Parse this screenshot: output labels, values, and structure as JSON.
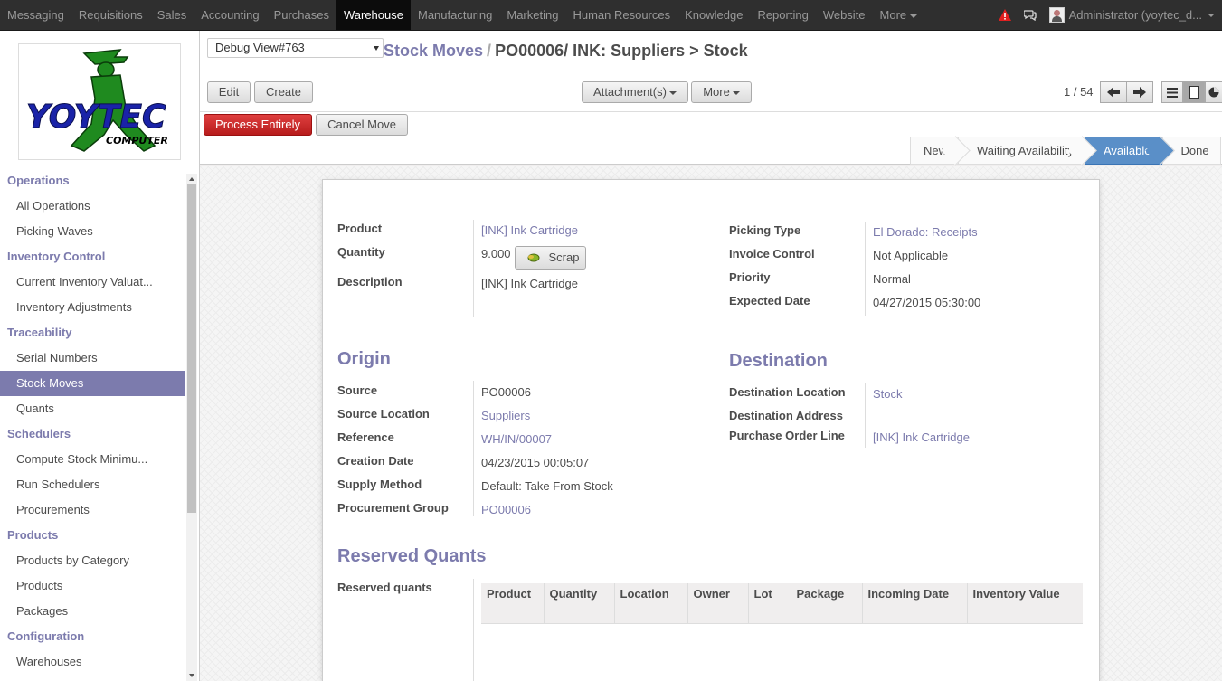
{
  "topbar": {
    "menu": [
      "Messaging",
      "Requisitions",
      "Sales",
      "Accounting",
      "Purchases",
      "Warehouse",
      "Manufacturing",
      "Marketing",
      "Human Resources",
      "Knowledge",
      "Reporting",
      "Website",
      "More"
    ],
    "active": "Warehouse",
    "user": "Administrator (yoytec_d..."
  },
  "sidebar": {
    "sections": [
      {
        "title": "Operations",
        "items": [
          "All Operations",
          "Picking Waves"
        ]
      },
      {
        "title": "Inventory Control",
        "items": [
          "Current Inventory Valuat...",
          "Inventory Adjustments"
        ]
      },
      {
        "title": "Traceability",
        "items": [
          "Serial Numbers",
          "Stock Moves",
          "Quants"
        ]
      },
      {
        "title": "Schedulers",
        "items": [
          "Compute Stock Minimu...",
          "Run Schedulers",
          "Procurements"
        ]
      },
      {
        "title": "Products",
        "items": [
          "Products by Category",
          "Products",
          "Packages"
        ]
      },
      {
        "title": "Configuration",
        "items": [
          "Warehouses"
        ]
      }
    ],
    "active_item": "Stock Moves",
    "logo_text": "YOYTEC",
    "logo_subtext": "COMPUTER"
  },
  "control": {
    "debug_view": "Debug View#763",
    "breadcrumb_parent": "Stock Moves",
    "breadcrumb_sep": "/",
    "breadcrumb_current": "PO00006/ INK: Suppliers > Stock",
    "edit": "Edit",
    "create": "Create",
    "attachments": "Attachment(s)",
    "more": "More",
    "pager": "1 / 54"
  },
  "statusbar": {
    "process": "Process Entirely",
    "cancel": "Cancel Move",
    "steps": [
      "New",
      "Waiting Availability",
      "Available",
      "Done"
    ],
    "active_step": "Available"
  },
  "form": {
    "left": {
      "product_label": "Product",
      "product_value": "[INK] Ink Cartridge",
      "quantity_label": "Quantity",
      "quantity_value": "9.000",
      "scrap_label": "Scrap",
      "description_label": "Description",
      "description_value": "[INK] Ink Cartridge"
    },
    "right": {
      "picking_type_label": "Picking Type",
      "picking_type_value": "El Dorado: Receipts",
      "invoice_control_label": "Invoice Control",
      "invoice_control_value": "Not Applicable",
      "priority_label": "Priority",
      "priority_value": "Normal",
      "expected_date_label": "Expected Date",
      "expected_date_value": "04/27/2015 05:30:00"
    },
    "origin": {
      "title": "Origin",
      "source_label": "Source",
      "source_value": "PO00006",
      "source_location_label": "Source Location",
      "source_location_value": "Suppliers",
      "reference_label": "Reference",
      "reference_value": "WH/IN/00007",
      "creation_date_label": "Creation Date",
      "creation_date_value": "04/23/2015 00:05:07",
      "supply_method_label": "Supply Method",
      "supply_method_value": "Default: Take From Stock",
      "procurement_group_label": "Procurement Group",
      "procurement_group_value": "PO00006"
    },
    "destination": {
      "title": "Destination",
      "dest_location_label": "Destination Location",
      "dest_location_value": "Stock",
      "dest_address_label": "Destination Address",
      "dest_address_value": "",
      "po_line_label": "Purchase Order Line",
      "po_line_value": "[INK] Ink Cartridge"
    },
    "reserved": {
      "title": "Reserved Quants",
      "label": "Reserved quants",
      "columns": [
        "Product",
        "Quantity",
        "Location",
        "Owner",
        "Lot",
        "Package",
        "Incoming Date",
        "Inventory Value"
      ]
    }
  },
  "colors": {
    "accent": "#7c7bad",
    "primary_button": "#c62828",
    "active_step": "#5a8fc8",
    "topbar": "#2f2f2f"
  }
}
